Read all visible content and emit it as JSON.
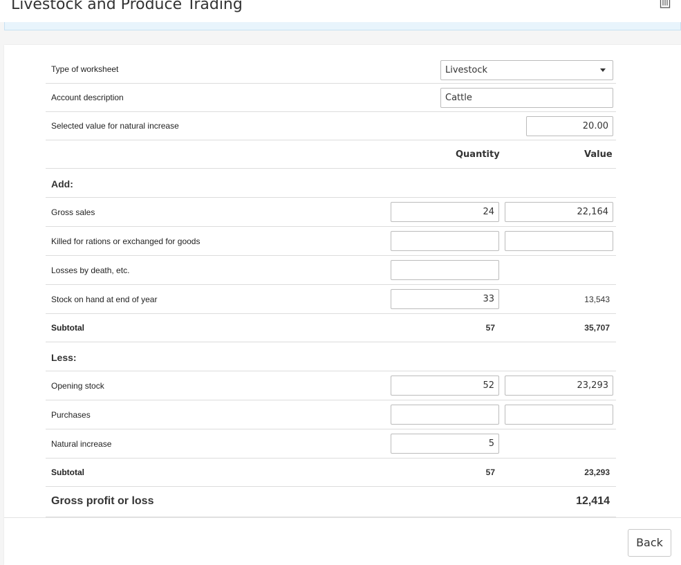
{
  "header": {
    "title": "Livestock and Produce Trading"
  },
  "form": {
    "worksheet_type": {
      "label": "Type of worksheet",
      "value": "Livestock"
    },
    "account_description": {
      "label": "Account description",
      "value": "Cattle"
    },
    "natural_increase_value": {
      "label": "Selected value for natural increase",
      "value": "20.00"
    }
  },
  "columns": {
    "quantity": "Quantity",
    "value": "Value"
  },
  "add": {
    "heading": "Add:",
    "gross_sales": {
      "label": "Gross sales",
      "quantity": "24",
      "value": "22,164"
    },
    "killed": {
      "label": "Killed for rations or exchanged for goods",
      "quantity": "",
      "value": ""
    },
    "losses": {
      "label": "Losses by death, etc.",
      "quantity": ""
    },
    "stock_end": {
      "label": "Stock on hand at end of year",
      "quantity": "33",
      "value": "13,543"
    },
    "subtotal": {
      "label": "Subtotal",
      "quantity": "57",
      "value": "35,707"
    }
  },
  "less": {
    "heading": "Less:",
    "opening_stock": {
      "label": "Opening stock",
      "quantity": "52",
      "value": "23,293"
    },
    "purchases": {
      "label": "Purchases",
      "quantity": "",
      "value": ""
    },
    "natural_increase": {
      "label": "Natural increase",
      "quantity": "5"
    },
    "subtotal": {
      "label": "Subtotal",
      "quantity": "57",
      "value": "23,293"
    }
  },
  "result": {
    "label": "Gross profit or loss",
    "value": "12,414"
  },
  "footer": {
    "back_label": "Back"
  },
  "icons": {
    "header_right": "trash-icon",
    "dropdown": "caret-down-icon"
  }
}
